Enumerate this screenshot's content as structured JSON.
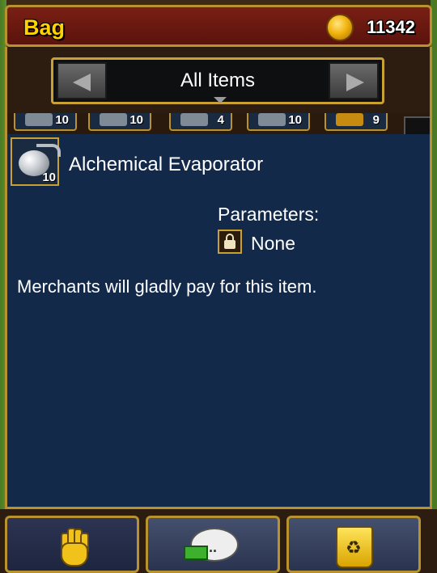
{
  "header": {
    "title": "Bag",
    "gold": "11342"
  },
  "filter": {
    "label": "All Items"
  },
  "strip": {
    "slots": [
      {
        "count": "10",
        "icon": "ore-icon"
      },
      {
        "count": "10",
        "icon": "ore-icon"
      },
      {
        "count": "4",
        "icon": "ore-icon"
      },
      {
        "count": "10",
        "icon": "ore-icon"
      },
      {
        "count": "9",
        "icon": "pickaxe-icon"
      }
    ]
  },
  "item": {
    "name": "Alchemical Evaporator",
    "count": "10",
    "icon": "evaporator-flask-icon",
    "parameters_label": "Parameters:",
    "parameters_value": "None",
    "description": "Merchants will gladly pay for this item."
  },
  "actions": [
    {
      "name": "hand-icon"
    },
    {
      "name": "trade-chat-icon"
    },
    {
      "name": "recycle-bin-icon"
    }
  ],
  "colors": {
    "panel": "#13294a",
    "border": "#b8922e",
    "title": "#ffd200",
    "header": "#7a1f14"
  }
}
